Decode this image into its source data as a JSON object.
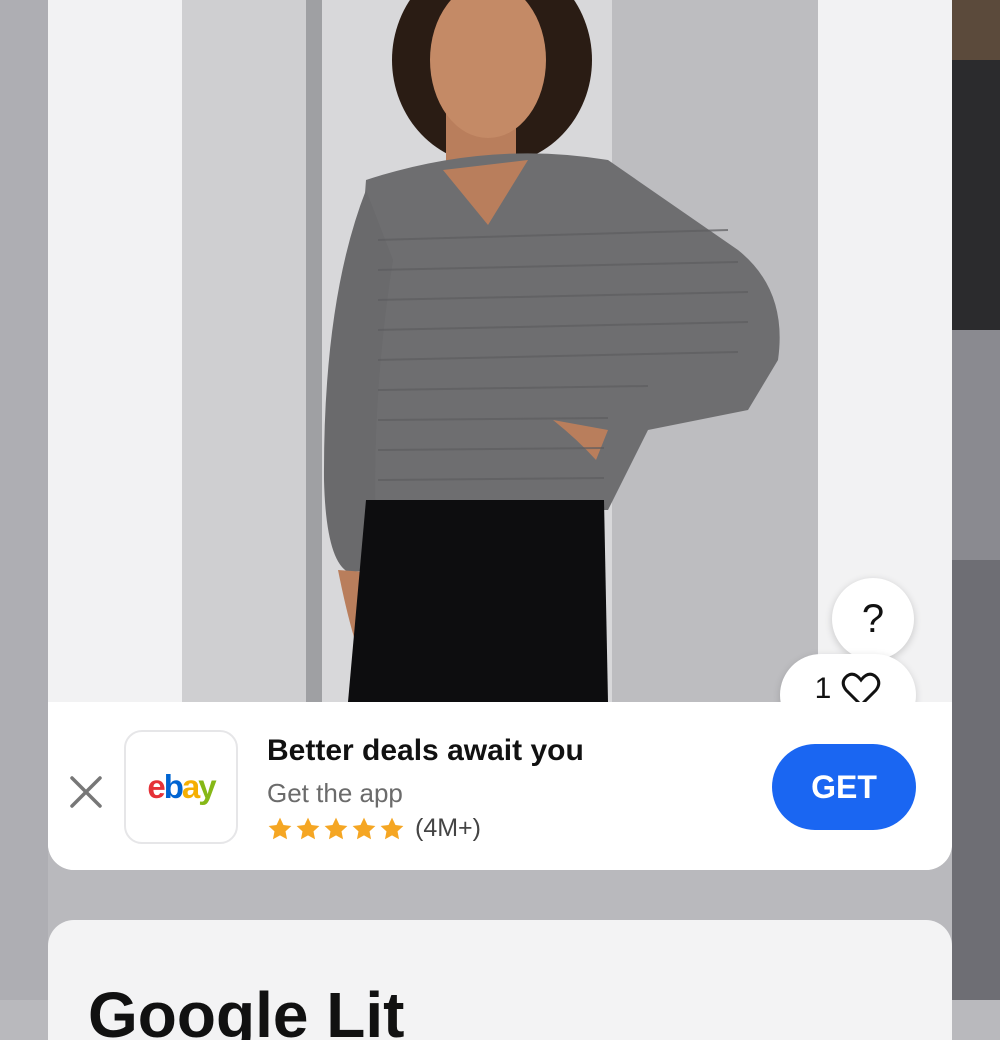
{
  "listing": {
    "help_label": "?",
    "watch_count": "1"
  },
  "app_banner": {
    "logo_text": [
      "e",
      "b",
      "a",
      "y"
    ],
    "title": "Better deals await you",
    "subtitle": "Get the app",
    "rating_stars": 5,
    "rating_count": "(4M+)",
    "get_label": "GET"
  },
  "next_section": {
    "title": "Google Lit"
  },
  "colors": {
    "accent": "#1a66f2",
    "star": "#f5a623"
  },
  "icons": [
    "close-icon",
    "heart-icon",
    "star-icon",
    "help-icon"
  ]
}
